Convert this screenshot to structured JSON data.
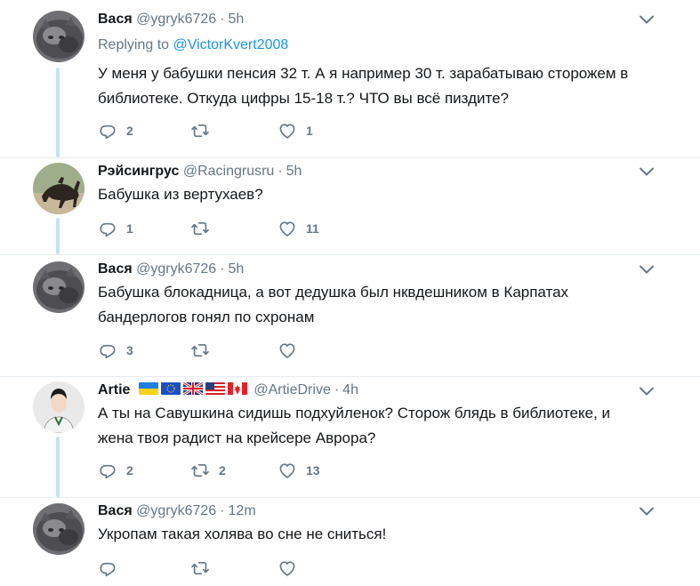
{
  "tweets": [
    {
      "name": "Вася",
      "handle": "@ygryk6726",
      "time": "5h",
      "reply_prefix": "Replying to",
      "reply_to": "@VictorKvert2008",
      "text_lines": [
        "У меня у бабушки пенсия 32 т. А я например 30 т. зарабатываю сторожем в",
        "библиотеке. Откуда цифры 15-18 т.? ЧТО вы всё пиздите?"
      ],
      "replies": "2",
      "retweets": "",
      "likes": "1"
    },
    {
      "name": "Рэйсингрус",
      "handle": "@Racingrusru",
      "time": "5h",
      "text_lines": [
        "Бабушка из вертухаев?"
      ],
      "replies": "1",
      "retweets": "",
      "likes": "11"
    },
    {
      "name": "Вася",
      "handle": "@ygryk6726",
      "time": "5h",
      "text_lines": [
        "Бабушка блокадница, а вот дедушка был нквдешником в Карпатах",
        "бандерлогов гонял по схронам"
      ],
      "replies": "3",
      "retweets": "",
      "likes": ""
    },
    {
      "name": "Artie",
      "handle": "@ArtieDrive",
      "time": "4h",
      "flags": [
        "ukraine-flag",
        "eu-flag",
        "uk-flag",
        "us-flag",
        "canada-flag"
      ],
      "text_lines": [
        "А ты на Савушкина сидишь подхуйленок? Сторож блядь в библиотеке, и",
        "жена твоя радист на крейсере Аврора?"
      ],
      "replies": "2",
      "retweets": "2",
      "likes": "13"
    },
    {
      "name": "Вася",
      "handle": "@ygryk6726",
      "time": "12m",
      "text_lines": [
        "Укропам такая холява во сне не сниться!"
      ],
      "replies": "",
      "retweets": "",
      "likes": ""
    }
  ],
  "colors": {
    "text": "#14171a",
    "secondary": "#657786",
    "link": "#1b95e0",
    "thread_line": "#c4e2f5",
    "separator": "#e6ecf0"
  }
}
